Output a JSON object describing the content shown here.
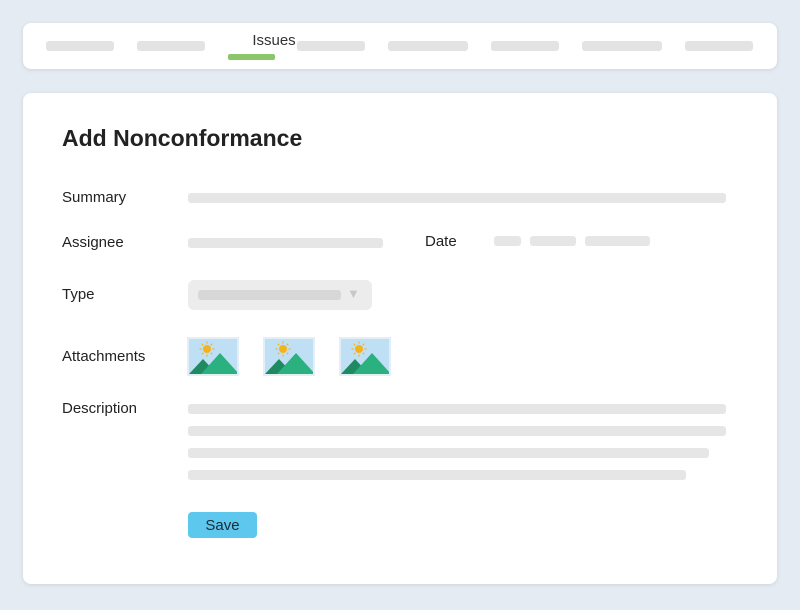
{
  "nav": {
    "active_tab": "Issues",
    "accent_color": "#8dc56b"
  },
  "form": {
    "title": "Add Nonconformance",
    "summary_label": "Summary",
    "assignee_label": "Assignee",
    "date_label": "Date",
    "type_label": "Type",
    "attachments_label": "Attachments",
    "description_label": "Description",
    "save_label": "Save",
    "save_color": "#5ec7ee",
    "attachments": [
      {
        "icon": "image-icon"
      },
      {
        "icon": "image-icon"
      },
      {
        "icon": "image-icon"
      }
    ]
  }
}
